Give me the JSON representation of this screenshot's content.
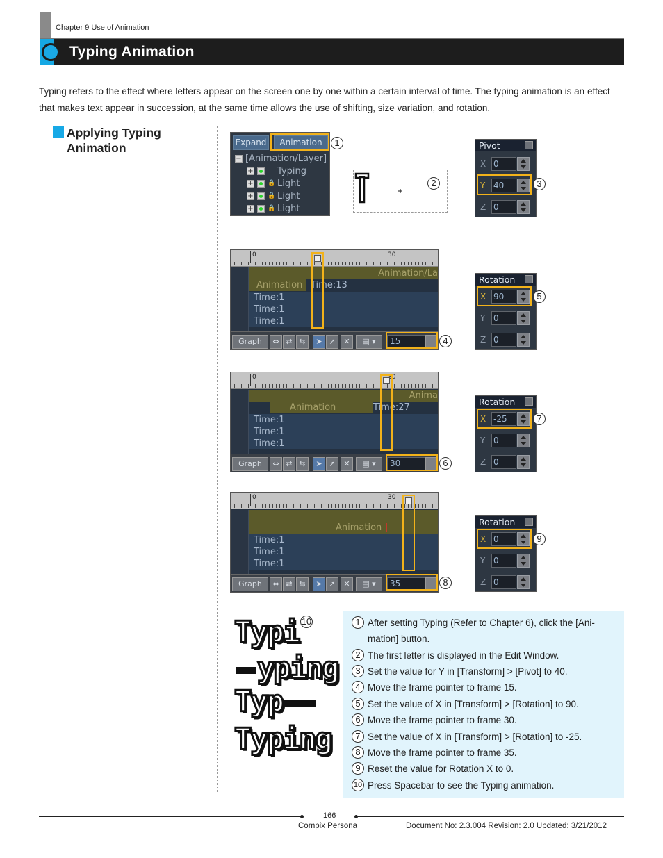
{
  "header": {
    "chapter": "Chapter 9 Use of Animation",
    "title": "Typing Animation"
  },
  "intro": "Typing refers to the effect where letters appear on the screen one by one within a certain interval of time. The typing animation is an effect that makes text appear in succession, at the same time allows the use of shifting, size variation, and rotation.",
  "section": {
    "title": "Applying Typing Animation"
  },
  "layer_panel": {
    "expand_label": "Expand",
    "animation_label": "Animation",
    "root": "[Animation/Layer]",
    "rows": [
      "Typing",
      "Light",
      "Light",
      "Light"
    ]
  },
  "pivot_panel": {
    "title": "Pivot",
    "x": "0",
    "y": "40",
    "z": "0",
    "labels": [
      "X",
      "Y",
      "Z"
    ]
  },
  "rotation_panels": [
    {
      "title": "Rotation",
      "x": "90",
      "y": "0",
      "z": "0"
    },
    {
      "title": "Rotation",
      "x": "-25",
      "y": "0",
      "z": "0"
    },
    {
      "title": "Rotation",
      "x": "0",
      "y": "0",
      "z": "0"
    }
  ],
  "timelines": [
    {
      "tick0": "0",
      "tick30": "30",
      "header": "Animation/La",
      "anim_label": "Animation",
      "time_label": "Time:13",
      "rows": [
        "Time:1",
        "Time:1",
        "Time:1"
      ],
      "graph": "Graph",
      "frame": "15"
    },
    {
      "tick0": "0",
      "tick30": "30",
      "header": "Anima",
      "anim_label": "Animation",
      "time_label": "Time:27",
      "rows": [
        "Time:1",
        "Time:1",
        "Time:1"
      ],
      "graph": "Graph",
      "frame": "30"
    },
    {
      "tick0": "0",
      "tick30": "30",
      "header": "",
      "anim_label": "Animation",
      "time_label": "",
      "rows": [
        "Time:1",
        "Time:1",
        "Time:1"
      ],
      "graph": "Graph",
      "frame": "35"
    }
  ],
  "typing_samples": [
    "Typi",
    "yping",
    "Typ",
    "Typing"
  ],
  "callouts": [
    "1",
    "2",
    "3",
    "4",
    "5",
    "6",
    "7",
    "8",
    "9",
    "10"
  ],
  "steps": [
    {
      "num": "1",
      "text": "After setting Typing (Refer to Chapter 6), click the [Ani-",
      "text2": "mation] button."
    },
    {
      "num": "2",
      "text": "The first letter is displayed in the Edit Window."
    },
    {
      "num": "3",
      "text": "Set the value for Y in [Transform] > [Pivot] to 40."
    },
    {
      "num": "4",
      "text": "Move the frame pointer to frame 15."
    },
    {
      "num": "5",
      "text": "Set the value of X in [Transform] > [Rotation] to 90."
    },
    {
      "num": "6",
      "text": "Move the frame pointer to frame 30."
    },
    {
      "num": "7",
      "text": "Set the value of X in [Transform] > [Rotation] to -25."
    },
    {
      "num": "8",
      "text": "Move the frame pointer to frame 35."
    },
    {
      "num": "9",
      "text": "Reset the value for Rotation X to 0."
    },
    {
      "num": "10",
      "text": "Press Spacebar to see the Typing animation."
    }
  ],
  "footer": {
    "page": "166",
    "product": "Compix Persona",
    "doc": "Document No: 2.3.004 Revision: 2.0 Updated: 3/21/2012"
  },
  "colors": {
    "accent": "#17a9e6",
    "highlight": "#f2b21a",
    "title_bar": "#1d1d1d"
  }
}
